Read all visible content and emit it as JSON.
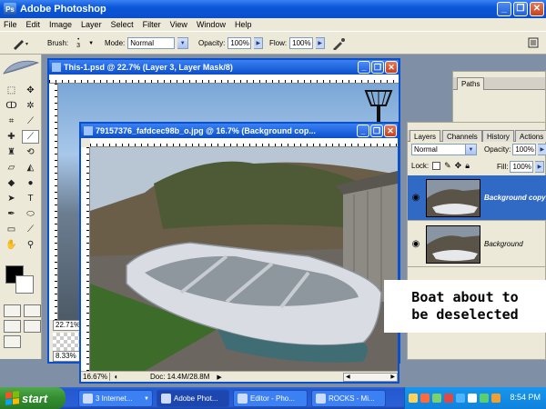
{
  "window": {
    "title": "Adobe Photoshop",
    "app_icon": "Ps"
  },
  "menu": [
    "File",
    "Edit",
    "Image",
    "Layer",
    "Select",
    "Filter",
    "View",
    "Window",
    "Help"
  ],
  "options": {
    "brush_label": "Brush:",
    "brush_size": "3",
    "mode_label": "Mode:",
    "mode_value": "Normal",
    "opacity_label": "Opacity:",
    "opacity_value": "100%",
    "flow_label": "Flow:",
    "flow_value": "100%"
  },
  "doc_back": {
    "title": "This-1.psd @ 22.7% (Layer 3, Layer Mask/8)",
    "zoom": "22.71%",
    "zoom2": "8.33%"
  },
  "doc_front": {
    "title": "79157376_fafdcec98b_o.jpg @ 16.7% (Background cop...",
    "zoom": "16.67%",
    "doc_info": "Doc: 14.4M/28.8M"
  },
  "paths_panel": {
    "tab": "Paths"
  },
  "layers_panel": {
    "tabs": [
      "Layers",
      "Channels",
      "History",
      "Actions"
    ],
    "blend_mode": "Normal",
    "opacity_label": "Opacity:",
    "opacity_value": "100%",
    "lock_label": "Lock:",
    "fill_label": "Fill:",
    "fill_value": "100%",
    "layers": [
      {
        "name": "Background copy",
        "selected": true
      },
      {
        "name": "Background",
        "selected": false
      }
    ]
  },
  "annotation": {
    "line1": "Boat about to",
    "line2": "be deselected"
  },
  "taskbar": {
    "start": "start",
    "tasks": [
      "3 Internet...",
      "Adobe Phot...",
      "Editor - Pho...",
      "ROCKS - Mi..."
    ],
    "clock": "8:54 PM"
  },
  "colors": {
    "title_blue": "#0a4fcb",
    "selected_layer": "#316ac5",
    "start_green": "#338e30"
  }
}
